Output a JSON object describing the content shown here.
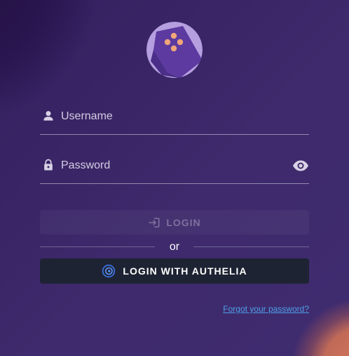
{
  "logo": {
    "icon": "app-logo-icon",
    "colors": {
      "circle": "#b69fdf",
      "shape": "#5c3aa0",
      "dots": "#f0a57a"
    }
  },
  "username": {
    "icon": "person-icon",
    "placeholder": "Username",
    "value": ""
  },
  "password": {
    "icon": "lock-icon",
    "placeholder": "Password",
    "value": "",
    "toggle_icon": "eye-icon"
  },
  "login_button": {
    "label": "LOGIN",
    "icon": "login-arrow-icon",
    "enabled": false
  },
  "divider": {
    "text": "or"
  },
  "sso_button": {
    "label": "LOGIN WITH AUTHELIA",
    "icon": "authelia-icon"
  },
  "forgot_link": {
    "label": "Forgot your password?"
  },
  "colors": {
    "background": "#3b2666",
    "sso_button_bg": "#1e2333",
    "link": "#4f9fe8"
  }
}
